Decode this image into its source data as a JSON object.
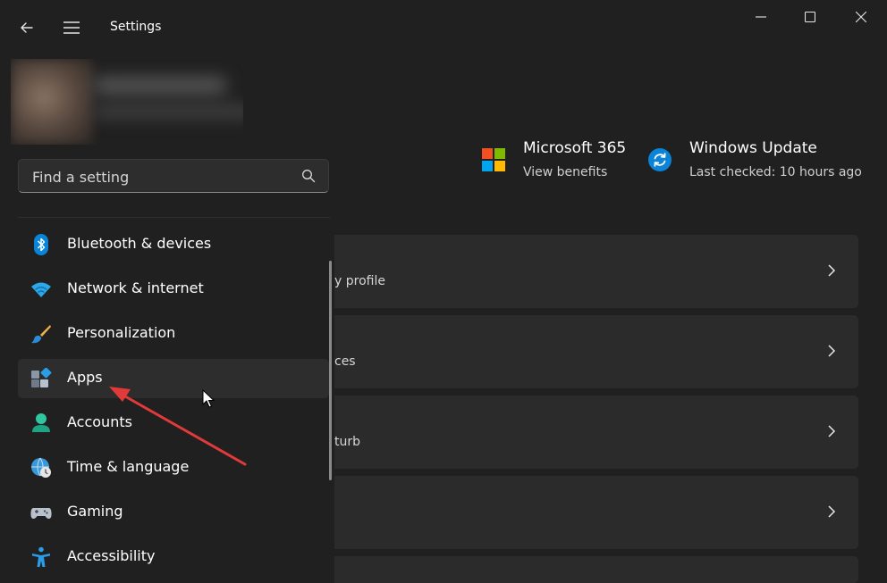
{
  "titlebar": {
    "title": "Settings"
  },
  "search": {
    "placeholder": "Find a setting"
  },
  "nav": {
    "items": [
      {
        "label": "Bluetooth & devices",
        "icon": "bluetooth-icon"
      },
      {
        "label": "Network & internet",
        "icon": "wifi-icon"
      },
      {
        "label": "Personalization",
        "icon": "paintbrush-icon"
      },
      {
        "label": "Apps",
        "icon": "apps-icon"
      },
      {
        "label": "Accounts",
        "icon": "accounts-icon"
      },
      {
        "label": "Time & language",
        "icon": "globe-clock-icon"
      },
      {
        "label": "Gaming",
        "icon": "gamepad-icon"
      },
      {
        "label": "Accessibility",
        "icon": "accessibility-icon"
      }
    ]
  },
  "promos": {
    "ms365": {
      "title": "Microsoft 365",
      "subtitle": "View benefits",
      "icon": "microsoft-logo-icon"
    },
    "update": {
      "title": "Windows Update",
      "subtitle": "Last checked: 10 hours ago",
      "icon": "windows-update-icon"
    }
  },
  "cards": [
    {
      "partial_text": "y profile"
    },
    {
      "partial_text": "ces"
    },
    {
      "partial_text": "turb"
    },
    {
      "partial_text": ""
    }
  ],
  "colors": {
    "background": "#202020",
    "card": "#2b2b2b",
    "accent_blue": "#0a84d8",
    "annotation_arrow": "#e03a3a"
  }
}
